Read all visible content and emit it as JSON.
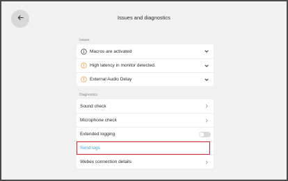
{
  "header": {
    "title": "Issues and diagnostics"
  },
  "issues": {
    "section_label": "Issues",
    "items": [
      {
        "label": "Macros are activated",
        "icon": "info-icon",
        "icon_color": "#2b2b2b"
      },
      {
        "label": "High latency in monitor detected.",
        "icon": "warning-icon",
        "icon_color": "#f0912b"
      },
      {
        "label": "External Audio Delay",
        "icon": "warning-icon",
        "icon_color": "#f0912b"
      }
    ]
  },
  "diagnostics": {
    "section_label": "Diagnostics",
    "items": [
      {
        "label": "Sound check"
      },
      {
        "label": "Microphone check"
      },
      {
        "label": "Extended logging",
        "toggle_on": false
      },
      {
        "label": "Send logs",
        "highlighted": true,
        "link_color": "#3ba5e0"
      },
      {
        "label": "Webex connection details"
      }
    ]
  },
  "colors": {
    "highlight": "#d9262e",
    "background": "#f1f1f1"
  }
}
